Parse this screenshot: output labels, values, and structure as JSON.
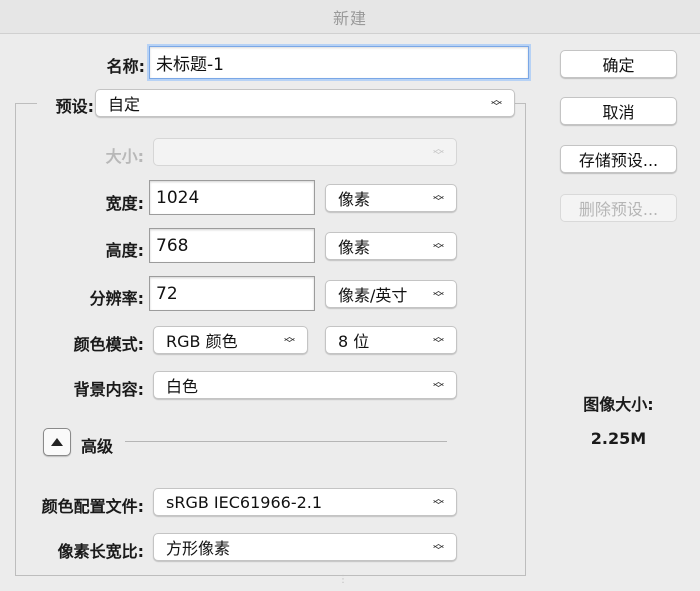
{
  "window": {
    "title": "新建"
  },
  "form": {
    "name_label": "名称:",
    "name_value": "未标题-1",
    "preset_label": "预设:",
    "preset_value": "自定",
    "size_label": "大小:",
    "size_value": "",
    "width_label": "宽度:",
    "width_value": "1024",
    "width_unit": "像素",
    "height_label": "高度:",
    "height_value": "768",
    "height_unit": "像素",
    "resolution_label": "分辨率:",
    "resolution_value": "72",
    "resolution_unit": "像素/英寸",
    "color_mode_label": "颜色模式:",
    "color_mode_value": "RGB 颜色",
    "bit_depth_value": "8 位",
    "background_label": "背景内容:",
    "background_value": "白色",
    "advanced_label": "高级",
    "color_profile_label": "颜色配置文件:",
    "color_profile_value": "sRGB IEC61966-2.1",
    "pixel_aspect_label": "像素长宽比:",
    "pixel_aspect_value": "方形像素"
  },
  "buttons": {
    "ok": "确定",
    "cancel": "取消",
    "save_preset": "存储预设...",
    "delete_preset": "删除预设..."
  },
  "image_size": {
    "label": "图像大小:",
    "value": "2.25M"
  }
}
